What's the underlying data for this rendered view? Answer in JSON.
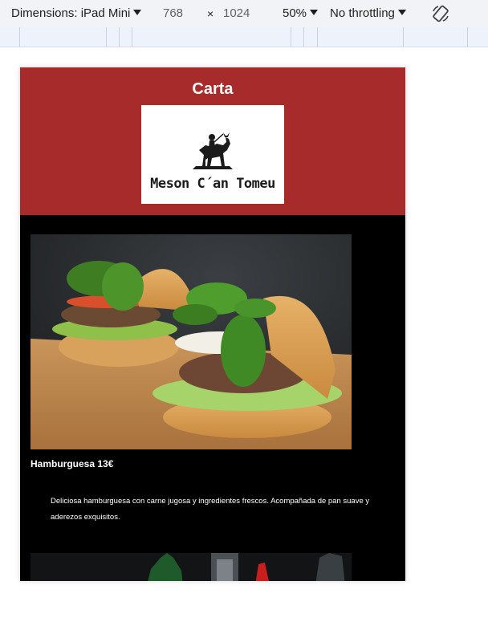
{
  "toolbar": {
    "dimensions_label": "Dimensions: iPad Mini",
    "width": "768",
    "times": "×",
    "height": "1024",
    "zoom": "50%",
    "throttling": "No throttling",
    "rotate_icon": "rotate-icon"
  },
  "page": {
    "title": "Carta",
    "logo_text": "Meson C´an Tomeu",
    "items": [
      {
        "title": "Hamburguesa 13€",
        "description": "Deliciosa hamburguesa con carne jugosa y ingredientes frescos. Acompañada de pan suave y aderezos exquisitos."
      }
    ]
  },
  "colors": {
    "header_bg": "#a72b2b",
    "body_bg": "#000000",
    "toolbar_bg": "#f1f3f7"
  }
}
